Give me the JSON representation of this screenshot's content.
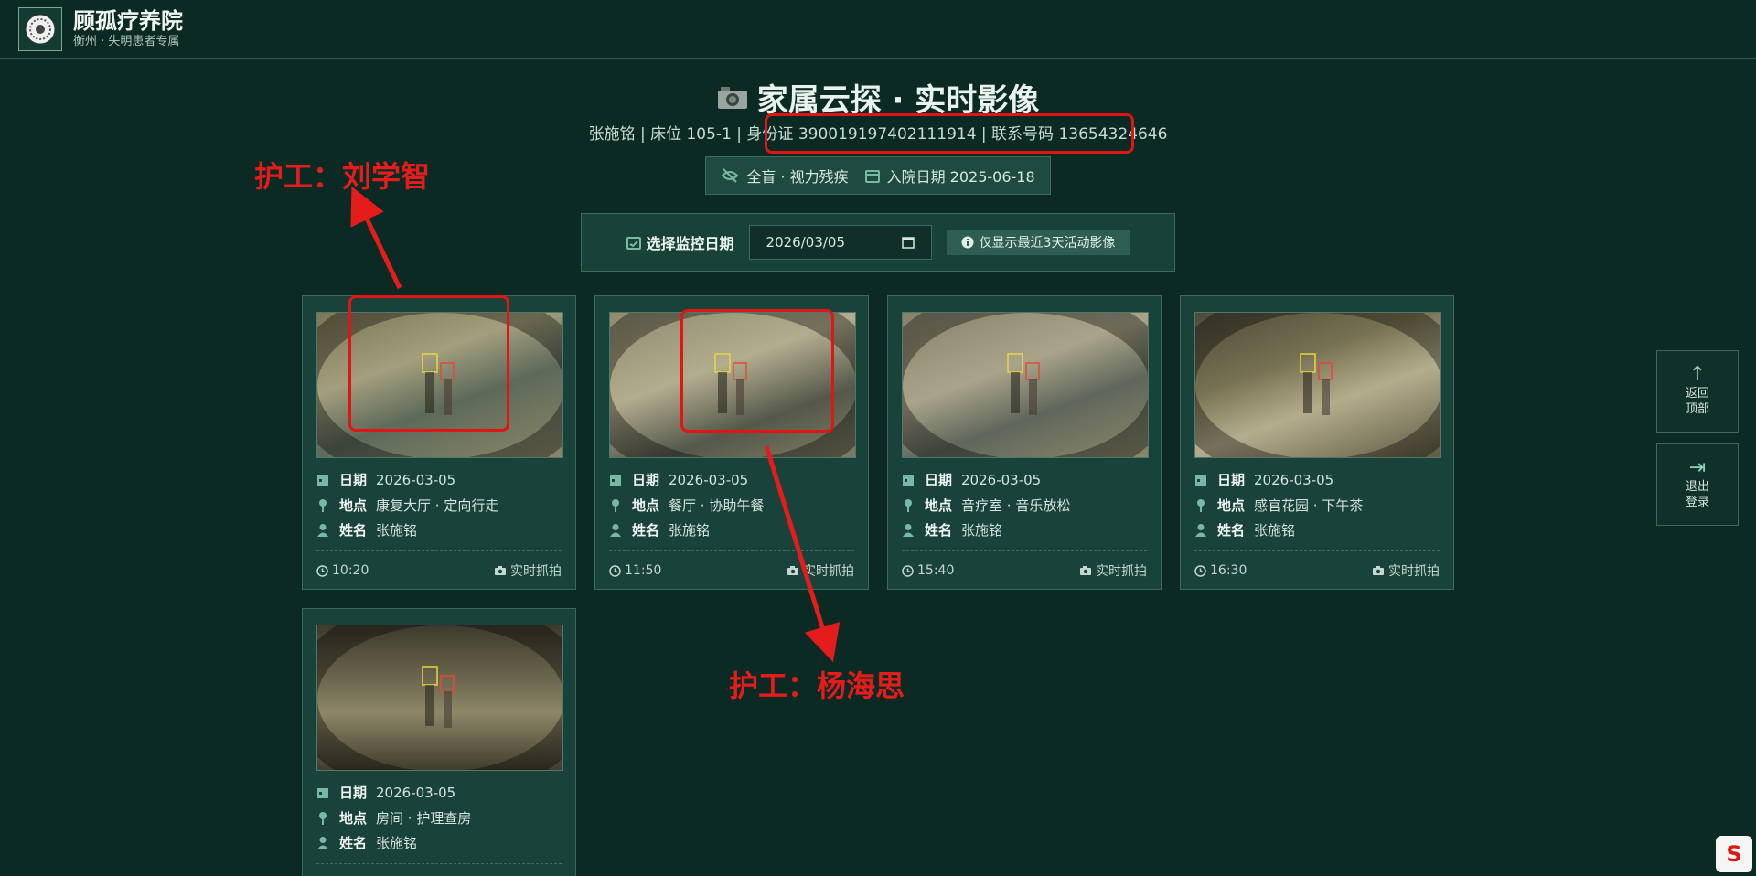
{
  "header": {
    "brand_name": "顾孤疗养院",
    "brand_sub": "衡州 · 失明患者专属"
  },
  "page": {
    "title": "家属云探 · 实时影像",
    "info_basic": "张施铭 | 床位 105-1 |",
    "info_id": "身份证 390019197402111914 | 联系号码 13654324646",
    "status_vision": "全盲 · 视力残疾",
    "status_admit": "入院日期 2025-06-18"
  },
  "date_picker": {
    "label": "选择监控日期",
    "value": "2026/03/05",
    "hint": "仅显示最近3天活动影像"
  },
  "labels": {
    "date": "日期",
    "location": "地点",
    "name": "姓名",
    "capture": "实时抓拍"
  },
  "cards": [
    {
      "date": "2026-03-05",
      "location": "康复大厅 · 定向行走",
      "name": "张施铭",
      "time": "10:20"
    },
    {
      "date": "2026-03-05",
      "location": "餐厅 · 协助午餐",
      "name": "张施铭",
      "time": "11:50"
    },
    {
      "date": "2026-03-05",
      "location": "音疗室 · 音乐放松",
      "name": "张施铭",
      "time": "15:40"
    },
    {
      "date": "2026-03-05",
      "location": "感官花园 · 下午茶",
      "name": "张施铭",
      "time": "16:30"
    },
    {
      "date": "2026-03-05",
      "location": "房间 · 护理查房",
      "name": "张施铭",
      "time": ""
    }
  ],
  "annotations": {
    "nurse_1": "护工：刘学智",
    "nurse_2": "护工：杨海思"
  },
  "float_buttons": {
    "top": "返回\n顶部",
    "logout": "退出\n登录"
  },
  "colors": {
    "background": "#0b2a23",
    "card": "#19433a",
    "accent": "#78b9a4",
    "annotation": "#e51c1c"
  }
}
